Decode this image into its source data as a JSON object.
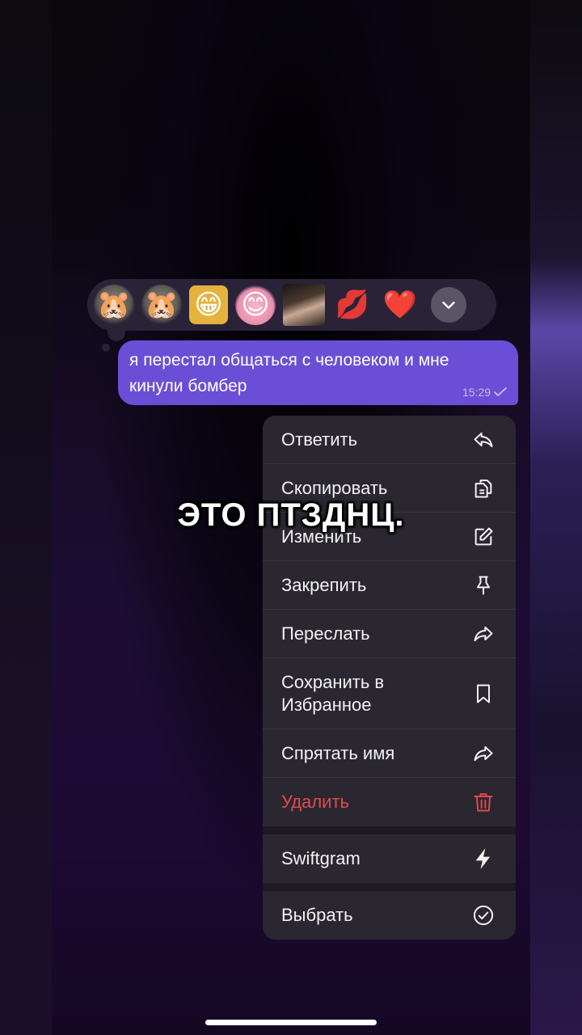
{
  "colors": {
    "accent": "#6a4fd6",
    "menu_bg": "#2a2730",
    "danger": "#e5484d",
    "reaction_bar_bg": "#2a2338"
  },
  "reactions": [
    {
      "name": "hamster-sticker",
      "glyph": "🐹"
    },
    {
      "name": "crying-hamster-sticker",
      "glyph": "🐹"
    },
    {
      "name": "spongebob-sticker",
      "glyph": "😁"
    },
    {
      "name": "pink-blob-sticker",
      "glyph": "😊"
    },
    {
      "name": "girl-photo-sticker",
      "glyph": ""
    },
    {
      "name": "lips-emoji",
      "glyph": "💋"
    },
    {
      "name": "heart-emoji",
      "glyph": "❤️"
    }
  ],
  "message": {
    "text": "я перестал общаться с человеком и мне кинули бомбер",
    "time": "15:29"
  },
  "menu": {
    "group1": [
      {
        "label": "Ответить",
        "icon": "reply-icon"
      },
      {
        "label": "Скопировать",
        "icon": "copy-icon"
      },
      {
        "label": "Изменить",
        "icon": "edit-icon"
      },
      {
        "label": "Закрепить",
        "icon": "pin-icon"
      },
      {
        "label": "Переслать",
        "icon": "forward-icon"
      },
      {
        "label": "Сохранить в Избранное",
        "icon": "bookmark-icon"
      },
      {
        "label": "Спрятать имя",
        "icon": "forward-icon"
      },
      {
        "label": "Удалить",
        "icon": "trash-icon"
      }
    ],
    "group2": [
      {
        "label": "Swiftgram",
        "icon": "lightning-icon"
      }
    ],
    "group3": [
      {
        "label": "Выбрать",
        "icon": "check-circle-icon"
      }
    ]
  },
  "caption": "ЭТО ПТЗДНЦ."
}
